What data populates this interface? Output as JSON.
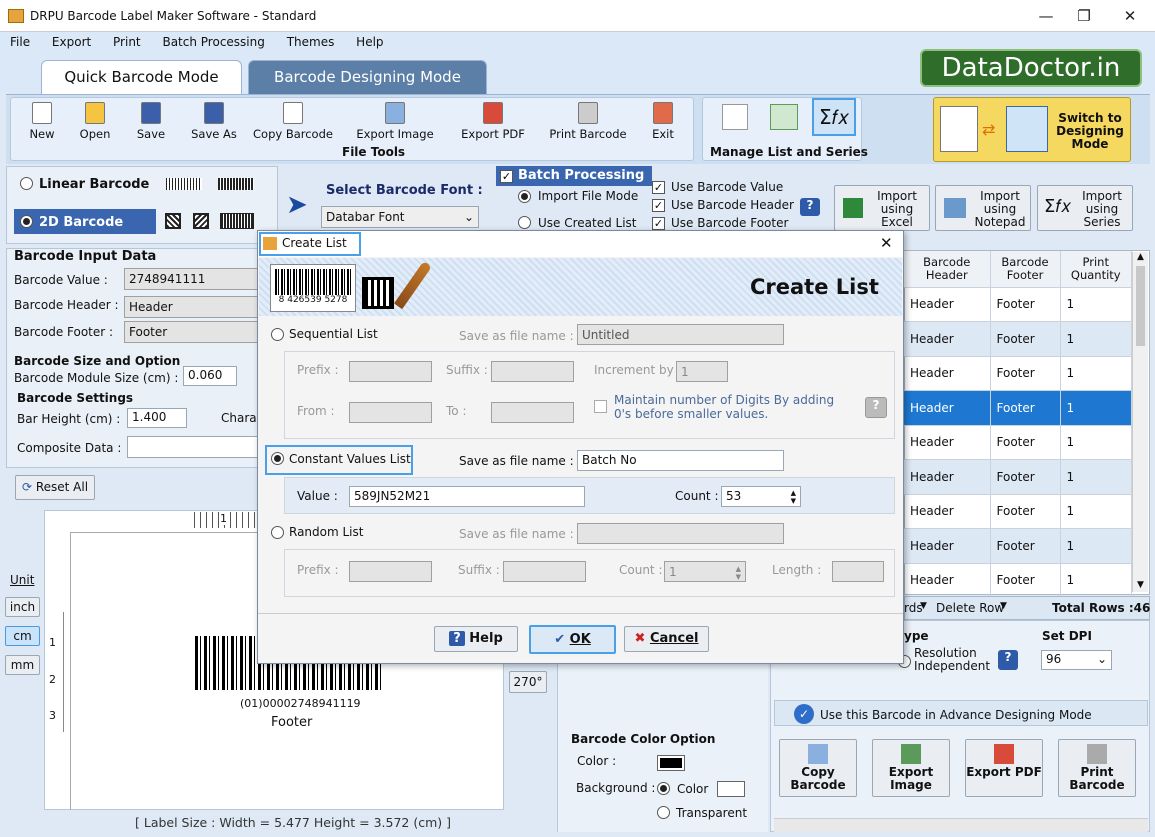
{
  "app": {
    "title": "DRPU Barcode Label Maker Software - Standard",
    "logo": "DataDoctor.in"
  },
  "menu": [
    "File",
    "Export",
    "Print",
    "Batch Processing",
    "Themes",
    "Help"
  ],
  "tabs": [
    "Quick Barcode Mode",
    "Barcode Designing Mode"
  ],
  "toolbar": {
    "file_tools": [
      "New",
      "Open",
      "Save",
      "Save As",
      "Copy Barcode",
      "Export Image",
      "Export PDF",
      "Print Barcode",
      "Exit"
    ],
    "file_tools_label": "File Tools",
    "manage_label": "Manage List and Series",
    "switch": "Switch to Designing Mode"
  },
  "barcode_type": {
    "linear": "Linear Barcode",
    "twod": "2D Barcode",
    "font_label": "Select Barcode Font :",
    "font_value": "Databar Font"
  },
  "batch": {
    "title": "Batch Processing",
    "import_file": "Import File Mode",
    "use_created": "Use Created List",
    "use_value": "Use Barcode Value",
    "use_header": "Use Barcode Header",
    "use_footer": "Use Barcode Footer",
    "import_excel": "Import using Excel",
    "import_notepad": "Import using Notepad",
    "import_series": "Import using Series"
  },
  "input": {
    "title": "Barcode Input Data",
    "value_label": "Barcode Value :",
    "value": "2748941111",
    "header_label": "Barcode Header :",
    "header": "Header",
    "footer_label": "Barcode Footer :",
    "footer": "Footer",
    "size_title": "Barcode Size and Option",
    "module_label": "Barcode Module Size (cm) :",
    "module": "0.060",
    "settings_title": "Barcode Settings",
    "bar_height_label": "Bar Height (cm) :",
    "bar_height": "1.400",
    "chara": "Chara",
    "composite_label": "Composite Data :",
    "reset": "Reset All"
  },
  "units": {
    "title": "Unit",
    "inch": "inch",
    "cm": "cm",
    "mm": "mm"
  },
  "preview": {
    "human": "(01)00002748941119",
    "footer": "Footer",
    "label_size": "[ Label Size : Width = 5.477  Height = 3.572 (cm) ]",
    "rotate": "270°",
    "ruler": [
      "1",
      "2",
      "3"
    ],
    "ruler_top": "1",
    "sample_digits": "8 426539 5278"
  },
  "grid": {
    "headers": [
      "Barcode Header",
      "Barcode Footer",
      "Print Quantity"
    ],
    "rows": [
      [
        "Header",
        "Footer",
        "1"
      ],
      [
        "Header",
        "Footer",
        "1"
      ],
      [
        "Header",
        "Footer",
        "1"
      ],
      [
        "Header",
        "Footer",
        "1"
      ],
      [
        "Header",
        "Footer",
        "1"
      ],
      [
        "Header",
        "Footer",
        "1"
      ],
      [
        "Header",
        "Footer",
        "1"
      ],
      [
        "Header",
        "Footer",
        "1"
      ],
      [
        "Header",
        "Footer",
        "1"
      ]
    ],
    "records": "rds",
    "delete_row": "Delete Row",
    "total_rows": "Total Rows :46"
  },
  "right": {
    "type_label": "ype",
    "resolution": "Resolution Independent",
    "dpi_label": "Set DPI",
    "dpi": "96",
    "advance": "Use this Barcode in Advance Designing Mode",
    "actions": [
      "Copy Barcode",
      "Export Image",
      "Export PDF",
      "Print Barcode"
    ]
  },
  "color_opt": {
    "title": "Barcode Color Option",
    "color": "Color :",
    "background": "Background :",
    "bg_color": "Color",
    "transparent": "Transparent"
  },
  "dialog": {
    "title": "Create List",
    "banner": "Create List",
    "sequential": "Sequential List",
    "save_as": "Save as file name :",
    "seq_file": "Untitled",
    "prefix": "Prefix :",
    "suffix": "Suffix :",
    "increment": "Increment by :",
    "increment_val": "1",
    "from": "From :",
    "to": "To :",
    "maintain": "Maintain number of Digits By adding 0's before smaller values.",
    "constant": "Constant Values List",
    "const_file": "Batch No",
    "value_label": "Value :",
    "value": "589JN52M21",
    "count_label": "Count :",
    "count": "53",
    "random": "Random List",
    "rand_prefix": "Prefix :",
    "rand_suffix": "Suffix :",
    "rand_count": "Count :",
    "rand_count_val": "1",
    "length": "Length :",
    "help": "Help",
    "ok": "OK",
    "cancel": "Cancel"
  }
}
